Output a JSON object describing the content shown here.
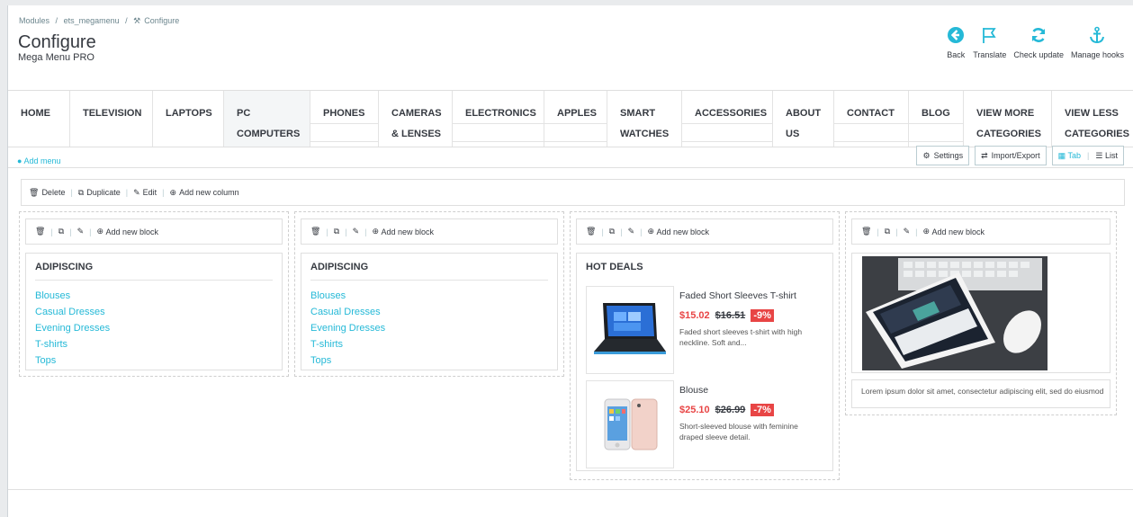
{
  "breadcrumb": [
    "Modules",
    "/",
    "ets_megamenu",
    "/",
    "Configure"
  ],
  "page": {
    "title": "Configure",
    "subtitle": "Mega Menu PRO"
  },
  "toolbar": [
    {
      "label": "Back",
      "icon": "back-icon"
    },
    {
      "label": "Translate",
      "icon": "flag-icon"
    },
    {
      "label": "Check update",
      "icon": "refresh-icon"
    },
    {
      "label": "Manage hooks",
      "icon": "anchor-icon"
    }
  ],
  "menu": [
    {
      "l1": "HOME",
      "l2": ""
    },
    {
      "l1": "TELEVISION",
      "l2": ""
    },
    {
      "l1": "LAPTOPS",
      "l2": ""
    },
    {
      "l1": "PC",
      "l2": "COMPUTERS"
    },
    {
      "l1": "PHONES",
      "l2": ""
    },
    {
      "l1": "CAMERAS",
      "l2": "& LENSES"
    },
    {
      "l1": "ELECTRONICS",
      "l2": ""
    },
    {
      "l1": "APPLES",
      "l2": ""
    },
    {
      "l1": "SMART",
      "l2": "WATCHES"
    },
    {
      "l1": "ACCESSORIES",
      "l2": ""
    },
    {
      "l1": "ABOUT",
      "l2": "US"
    },
    {
      "l1": "CONTACT",
      "l2": ""
    },
    {
      "l1": "BLOG",
      "l2": ""
    },
    {
      "l1": "VIEW MORE",
      "l2": "CATEGORIES"
    },
    {
      "l1": "VIEW LESS",
      "l2": "CATEGORIES"
    }
  ],
  "add_menu": "Add menu",
  "settings_btn": "Settings",
  "import_btn": "Import/Export",
  "view_tab": "Tab",
  "view_list": "List",
  "column_actions": {
    "delete": "Delete",
    "duplicate": "Duplicate",
    "edit": "Edit",
    "add_column": "Add new column"
  },
  "add_block": "Add new block",
  "columns": [
    {
      "title": "ADIPISCING",
      "links": [
        "Blouses",
        "Casual Dresses",
        "Evening Dresses",
        "T-shirts",
        "Tops"
      ]
    },
    {
      "title": "ADIPISCING",
      "links": [
        "Blouses",
        "Casual Dresses",
        "Evening Dresses",
        "T-shirts",
        "Tops"
      ]
    },
    {
      "title": "HOT DEALS",
      "products": [
        {
          "name": "Faded Short Sleeves T-shirt",
          "price": "$15.02",
          "old_price": "$16.51",
          "discount": "-9%",
          "description": "Faded short sleeves t-shirt with high neckline. Soft and..."
        },
        {
          "name": "Blouse",
          "price": "$25.10",
          "old_price": "$26.99",
          "discount": "-7%",
          "description": "Short-sleeved blouse with feminine draped sleeve detail."
        }
      ]
    },
    {
      "text": "Lorem ipsum dolor sit amet, consectetur adipiscing elit, sed do eiusmod"
    }
  ],
  "colors": {
    "accent": "#25b9d7",
    "price": "#e84545",
    "text": "#363a41"
  }
}
